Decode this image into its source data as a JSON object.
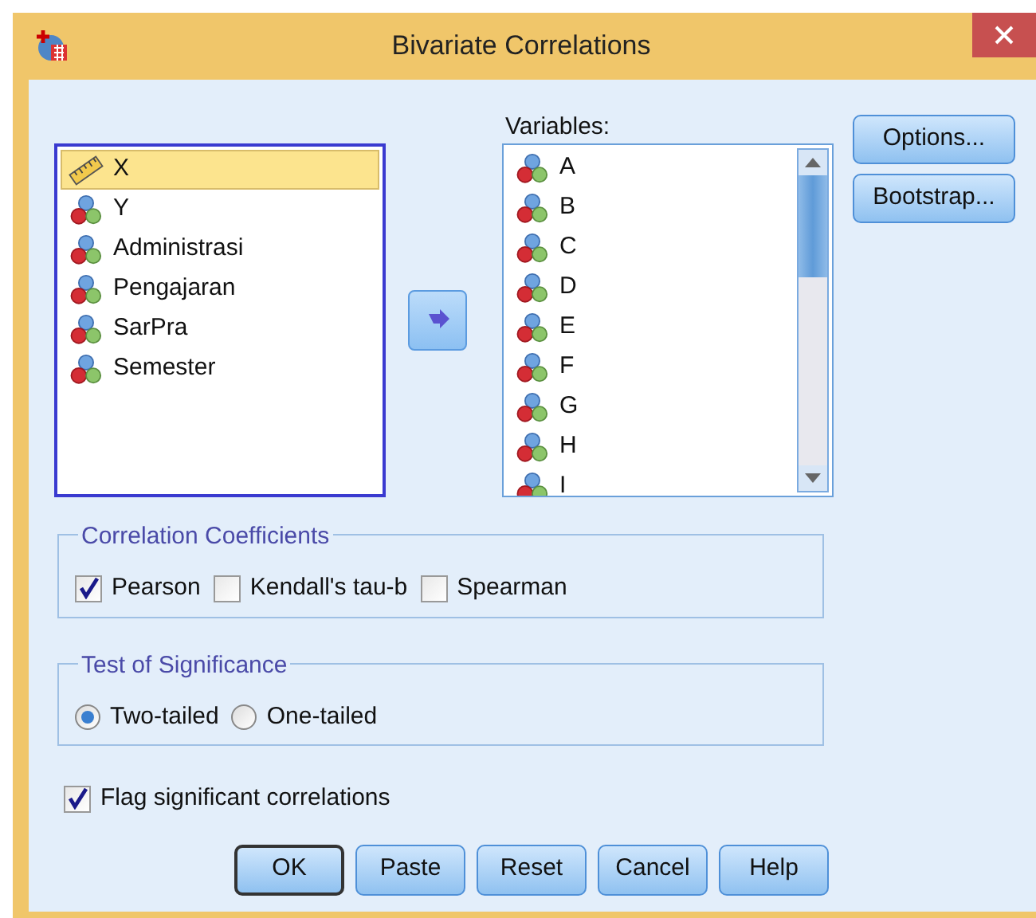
{
  "window": {
    "title": "Bivariate Correlations"
  },
  "source_variables": [
    {
      "name": "X",
      "kind": "scale",
      "selected": true
    },
    {
      "name": "Y",
      "kind": "nominal",
      "selected": false
    },
    {
      "name": "Administrasi",
      "kind": "nominal",
      "selected": false
    },
    {
      "name": "Pengajaran",
      "kind": "nominal",
      "selected": false
    },
    {
      "name": "SarPra",
      "kind": "nominal",
      "selected": false
    },
    {
      "name": "Semester",
      "kind": "nominal",
      "selected": false
    }
  ],
  "variables": {
    "label": "Variables:",
    "items": [
      {
        "name": "A",
        "kind": "nominal",
        "selected": false
      },
      {
        "name": "B",
        "kind": "nominal",
        "selected": false
      },
      {
        "name": "C",
        "kind": "nominal",
        "selected": false
      },
      {
        "name": "D",
        "kind": "nominal",
        "selected": false
      },
      {
        "name": "E",
        "kind": "nominal",
        "selected": false
      },
      {
        "name": "F",
        "kind": "nominal",
        "selected": false
      },
      {
        "name": "G",
        "kind": "nominal",
        "selected": false
      },
      {
        "name": "H",
        "kind": "nominal",
        "selected": false
      },
      {
        "name": "I",
        "kind": "nominal",
        "selected": false
      }
    ]
  },
  "side_buttons": [
    "Options...",
    "Bootstrap..."
  ],
  "correlation_coefficients": {
    "title": "Correlation Coefficients",
    "options": [
      {
        "label": "Pearson",
        "checked": true
      },
      {
        "label": "Kendall's tau-b",
        "checked": false
      },
      {
        "label": "Spearman",
        "checked": false
      }
    ]
  },
  "test_of_significance": {
    "title": "Test of Significance",
    "options": [
      {
        "label": "Two-tailed",
        "selected": true
      },
      {
        "label": "One-tailed",
        "selected": false
      }
    ]
  },
  "flag_significant": {
    "label": "Flag significant correlations",
    "checked": true
  },
  "buttons": [
    {
      "label": "OK",
      "default": true
    },
    {
      "label": "Paste",
      "default": false
    },
    {
      "label": "Reset",
      "default": false
    },
    {
      "label": "Cancel",
      "default": false
    },
    {
      "label": "Help",
      "default": false
    }
  ]
}
